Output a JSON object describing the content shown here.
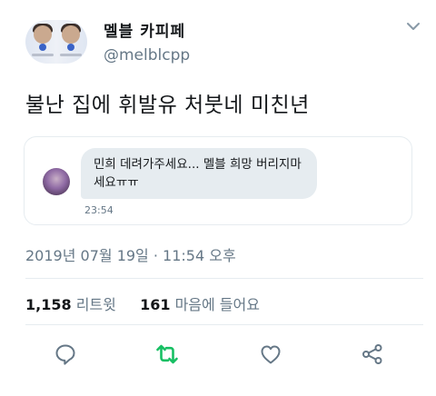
{
  "user": {
    "display_name": "멜블 카피페",
    "handle": "@melblcpp"
  },
  "tweet": {
    "text": "불난 집에 휘발유 처붓네 미친년",
    "timestamp": "2019년 07월 19일 · 11:54 오후"
  },
  "quoted_dm": {
    "message": "민희 데려가주세요... 멜블 희망 버리지마\n세요ㅠㅠ",
    "time": "23:54"
  },
  "stats": {
    "retweets_count": "1,158",
    "retweets_label": "리트윗",
    "likes_count": "161",
    "likes_label": "마음에 들어요"
  },
  "actions": [
    {
      "name": "reply-icon",
      "color": "#657786"
    },
    {
      "name": "retweet-icon",
      "color": "#17bf63"
    },
    {
      "name": "like-icon",
      "color": "#657786"
    },
    {
      "name": "share-icon",
      "color": "#657786"
    }
  ],
  "colors": {
    "text": "#14171a",
    "secondary": "#657786",
    "retweet_active": "#17bf63",
    "border": "#e6ecf0"
  }
}
